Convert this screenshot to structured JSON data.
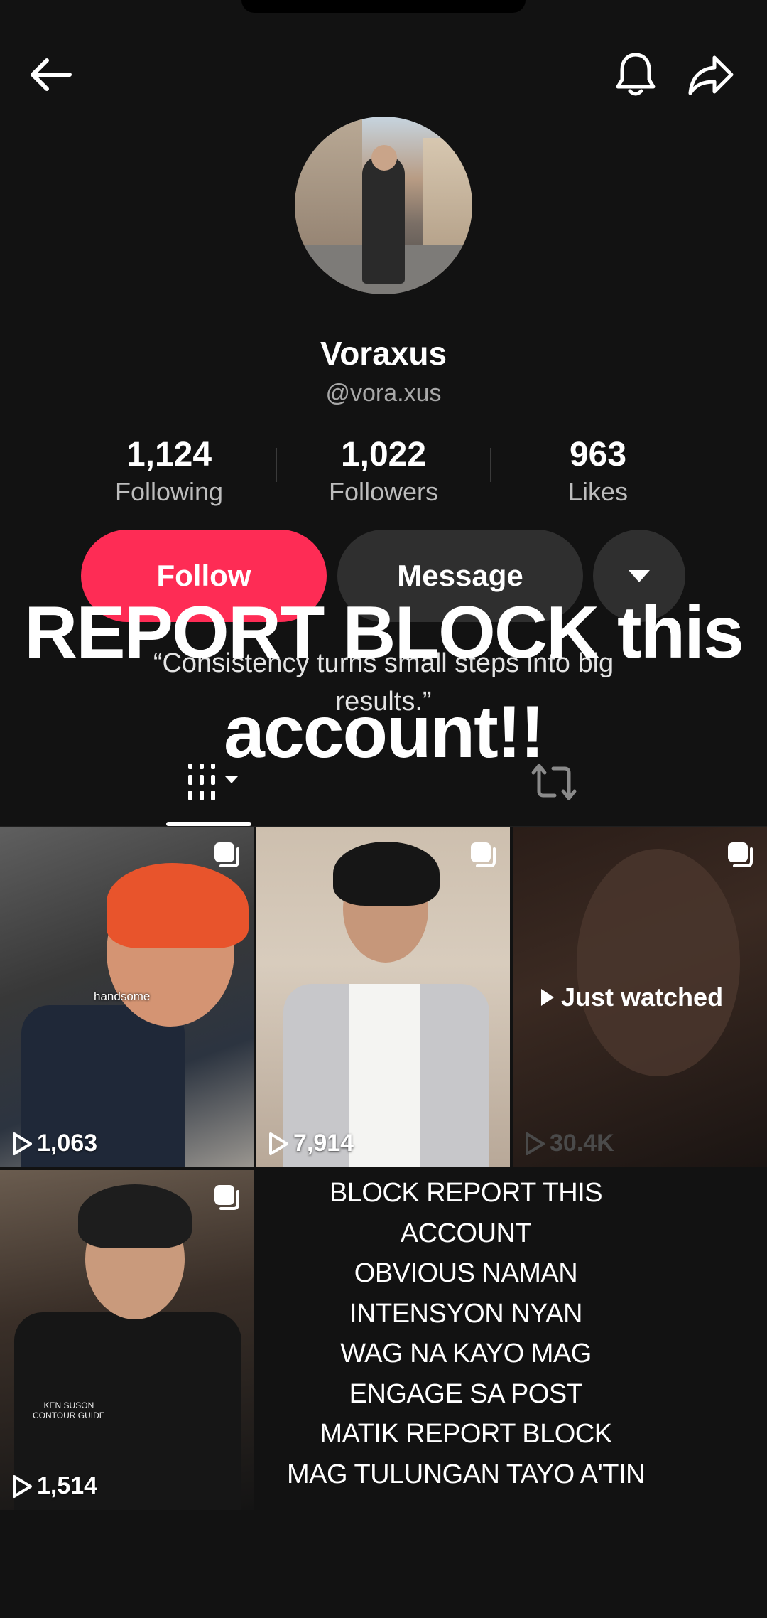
{
  "profile": {
    "name": "Voraxus",
    "handle": "@vora.xus",
    "bio": "“Consistency turns small steps into big results.”"
  },
  "stats": [
    {
      "value": "1,124",
      "label": "Following"
    },
    {
      "value": "1,022",
      "label": "Followers"
    },
    {
      "value": "963",
      "label": "Likes"
    }
  ],
  "actions": {
    "follow": "Follow",
    "message": "Message"
  },
  "overlay": {
    "title_line1": "REPORT BLOCK this",
    "title_line2": "account!!"
  },
  "videos": [
    {
      "views": "1,063",
      "caption": "handsome"
    },
    {
      "views": "7,914"
    },
    {
      "views": "30.4K",
      "badge": "Just watched"
    },
    {
      "views": "1,514",
      "caption_line1": "KEN SUSON",
      "caption_line2": "CONTOUR GUIDE"
    }
  ],
  "notice": [
    "BLOCK REPORT THIS",
    "ACCOUNT",
    "OBVIOUS NAMAN",
    "INTENSYON NYAN",
    "WAG NA KAYO MAG",
    "ENGAGE SA POST",
    "MATIK REPORT BLOCK",
    "MAG TULUNGAN TAYO A'TIN"
  ],
  "colors": {
    "background": "#121212",
    "follow_button": "#fe2c55",
    "secondary_button": "#2f2f2f"
  },
  "icons": [
    "back-arrow-icon",
    "bell-icon",
    "share-icon",
    "chevron-down-icon",
    "grid-icon",
    "repost-icon",
    "multi-image-icon",
    "play-icon"
  ]
}
